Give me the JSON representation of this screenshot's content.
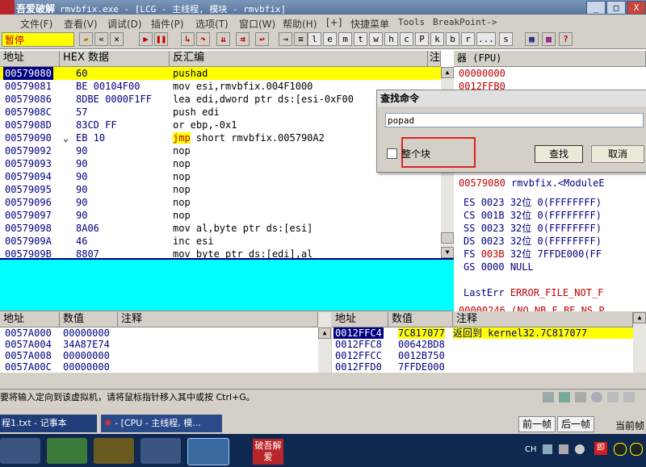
{
  "window": {
    "title": "rmvbfix.exe - [LCG - 主线程, 模块 - rmvbfix]",
    "logo_text": "吾爱破解",
    "min_label": "_",
    "max_label": "□",
    "close_label": "X"
  },
  "menu": [
    "文件(F)",
    "查看(V)",
    "调试(D)",
    "插件(P)",
    "选项(T)",
    "窗口(W)",
    "帮助(H)",
    "[+]",
    "快捷菜单",
    "Tools",
    "BreakPoint->"
  ],
  "toolbar": {
    "status": "暂停",
    "letters": [
      "l",
      "e",
      "m",
      "t",
      "w",
      "h",
      "c",
      "P",
      "k",
      "b",
      "r",
      "...",
      "s"
    ]
  },
  "disasm": {
    "headers": {
      "addr": "地址",
      "hex": "HEX 数据",
      "asm": "反汇编",
      "comment": "注"
    },
    "rows": [
      {
        "addr": "00579080",
        "hex": "60",
        "asm": "pushad",
        "selected": true
      },
      {
        "addr": "00579081",
        "hex": "BE 00104F00",
        "asm": "mov esi,rmvbfix.004F1000"
      },
      {
        "addr": "00579086",
        "hex": "8DBE 0000F1FF",
        "asm": "lea edi,dword ptr ds:[esi-0xF00"
      },
      {
        "addr": "0057908C",
        "hex": "57",
        "asm": "push edi"
      },
      {
        "addr": "0057908D",
        "hex": "83CD FF",
        "asm": "or ebp,-0x1"
      },
      {
        "addr": "00579090",
        "hex": "EB 10",
        "asm": "jmp short rmvbfix.005790A2",
        "jmp": true
      },
      {
        "addr": "00579092",
        "hex": "90",
        "asm": "nop"
      },
      {
        "addr": "00579093",
        "hex": "90",
        "asm": "nop"
      },
      {
        "addr": "00579094",
        "hex": "90",
        "asm": "nop"
      },
      {
        "addr": "00579095",
        "hex": "90",
        "asm": "nop"
      },
      {
        "addr": "00579096",
        "hex": "90",
        "asm": "nop"
      },
      {
        "addr": "00579097",
        "hex": "90",
        "asm": "nop"
      },
      {
        "addr": "00579098",
        "hex": "8A06",
        "asm": "mov al,byte ptr ds:[esi]"
      },
      {
        "addr": "0057909A",
        "hex": "46",
        "asm": "inc esi"
      },
      {
        "addr": "0057909B",
        "hex": "8807",
        "asm": "mov byte ptr ds:[edi],al"
      }
    ],
    "jmp_mnemonic": "jmp",
    "jmp_rest": " short rmvbfix.005790A2"
  },
  "registers": {
    "header": "器 (FPU)",
    "top": [
      "00000000",
      "0012FFB0"
    ],
    "module_line": {
      "addr": "00579080",
      "text": "rmvbfix.<ModuleE"
    },
    "segments": [
      {
        "name": "ES",
        "sel": "0023",
        "bits": "32位",
        "val": "0(FFFFFFFF)"
      },
      {
        "name": "CS",
        "sel": "001B",
        "bits": "32位",
        "val": "0(FFFFFFFF)"
      },
      {
        "name": "SS",
        "sel": "0023",
        "bits": "32位",
        "val": "0(FFFFFFFF)"
      },
      {
        "name": "DS",
        "sel": "0023",
        "bits": "32位",
        "val": "0(FFFFFFFF)"
      },
      {
        "name": "FS",
        "sel": "003B",
        "bits": "32位",
        "val": "7FFDE000(FF"
      },
      {
        "name": "GS",
        "sel": "0000",
        "bits": "NULL",
        "val": ""
      }
    ],
    "lasterr_label": "LastErr",
    "lasterr_value": "ERROR_FILE_NOT_F",
    "efl_partial": "00000246 (NO,NB,E,BE,NS,P"
  },
  "dialog": {
    "title": "查找命令",
    "input_value": "popad",
    "checkbox_label": "整个块",
    "find_button": "查找",
    "cancel_button": "取消"
  },
  "dump": {
    "headers": {
      "addr": "地址",
      "value": "数值",
      "comment": "注释"
    },
    "rows": [
      {
        "addr": "0057A000",
        "value": "00000000"
      },
      {
        "addr": "0057A004",
        "value": "34A87E74"
      },
      {
        "addr": "0057A008",
        "value": "00000000"
      },
      {
        "addr": "0057A00C",
        "value": "00000000"
      }
    ]
  },
  "stack": {
    "headers": {
      "addr": "地址",
      "value": "数值",
      "comment": "注释"
    },
    "rows": [
      {
        "addr": "0012FFC4",
        "value": "7C817077",
        "comment": "返回到 kernel32.7C817077",
        "selected": true
      },
      {
        "addr": "0012FFC8",
        "value": "00642BD8",
        "comment": ""
      },
      {
        "addr": "0012FFCC",
        "value": "0012B750",
        "comment": ""
      },
      {
        "addr": "0012FFD0",
        "value": "7FFDE000",
        "comment": ""
      }
    ]
  },
  "statusbar": {
    "text": "要将输入定向到该虚拟机，请将鼠标指针移入其中或按 Ctrl+G。"
  },
  "taskbar": {
    "tasks": [
      "程1.txt - 记事本",
      "- [CPU - 主线程, 模..."
    ],
    "right_buttons": [
      "前一帧",
      "后一帧"
    ],
    "right_text": "当前帧",
    "tray_lang": "CH",
    "tray_app": "即",
    "app_logo": "破吾解爱"
  },
  "colors": {
    "accent": "#000080",
    "highlight": "#ffff00",
    "cyan": "#00ffff",
    "red": "#c00000"
  }
}
